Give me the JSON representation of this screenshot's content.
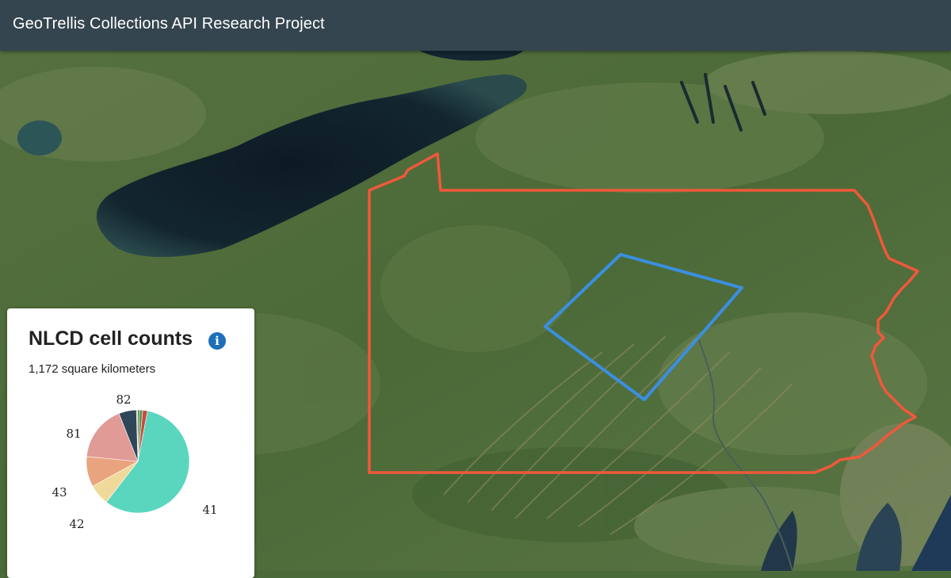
{
  "navbar": {
    "title": "GeoTrellis Collections API Research Project"
  },
  "panel": {
    "title": "NLCD cell counts",
    "info_icon": "info-icon",
    "subtitle": "1,172 square kilometers"
  },
  "map": {
    "basemap": "satellite imagery",
    "state_boundary_color": "#f0583a",
    "area_of_interest_color": "#3a8fe0"
  },
  "chart_data": {
    "type": "pie",
    "title": "NLCD cell counts",
    "slices": [
      {
        "label": "",
        "value": 0.4,
        "color": "#d7c07a"
      },
      {
        "label": "",
        "value": 0.6,
        "color": "#3b8a4a"
      },
      {
        "label": "",
        "value": 1.0,
        "color": "#5f8f55"
      },
      {
        "label": "",
        "value": 1.5,
        "color": "#c94b3c"
      },
      {
        "label": "41",
        "value": 57.5,
        "color": "#5ad6bf"
      },
      {
        "label": "42",
        "value": 6.5,
        "color": "#f0d99a"
      },
      {
        "label": "43",
        "value": 9.5,
        "color": "#e9a47f"
      },
      {
        "label": "81",
        "value": 17.5,
        "color": "#e19b97"
      },
      {
        "label": "82",
        "value": 5.5,
        "color": "#2f4558"
      }
    ]
  }
}
